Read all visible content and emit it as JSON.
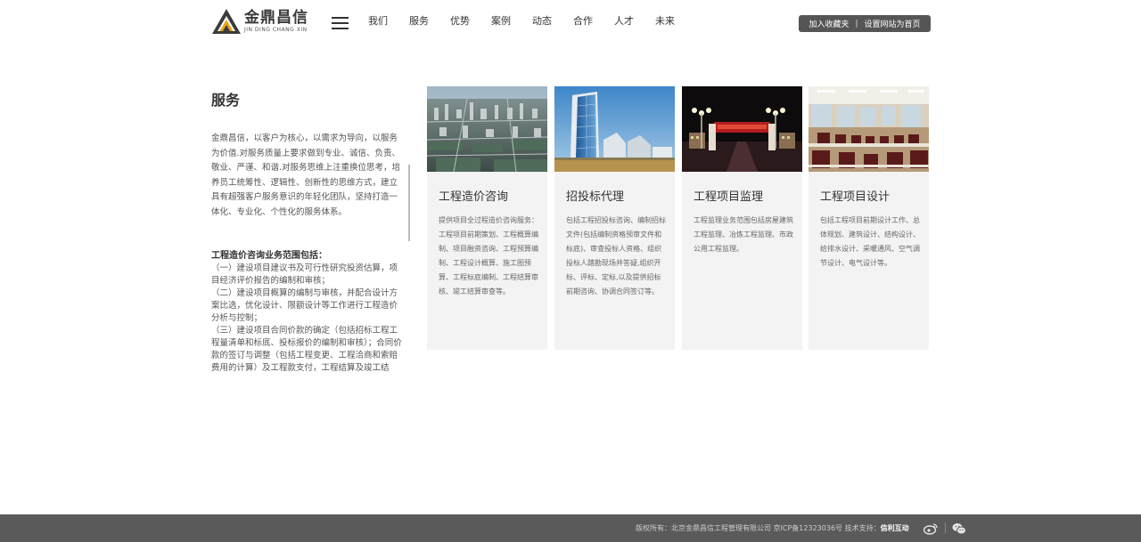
{
  "brand": {
    "name_cn": "金鼎昌信",
    "name_en": "JIN DING CHANG XIN"
  },
  "nav": {
    "items": [
      "我们",
      "服务",
      "优势",
      "案例",
      "动态",
      "合作",
      "人才",
      "未来"
    ]
  },
  "top_actions": {
    "bookmark": "加入收藏夹",
    "separator": "|",
    "homepage": "设置网站为首页"
  },
  "sidebar": {
    "title": "服务",
    "intro": "金鼎昌信，以客户为核心，以需求为导向，以服务为价值.对服务质量上要求做到专业、诚信、负责、敬业、严谨、和谐.对服务思维上注重换位思考，培养员工统筹性、逻辑性、创新性的思维方式，建立具有超强客户服务意识的年轻化团队，坚持打造一体化、专业化、个性化的服务体系。",
    "scope_title": "工程造价咨询业务范围包括：",
    "scope_items": [
      "（一）建设项目建议书及可行性研究投资估算，项目经济评价报告的编制和审核；",
      "（二）建设项目概算的编制与审核，并配合设计方案比选，优化设计、限额设计等工作进行工程造价分析与控制；",
      "（三）建设项目合同价款的确定（包括招标工程工程量清单和标底、投标报价的编制和审核）；合同价款的签订与调整（包括工程变更、工程洽商和索赔费用的计算）及工程款支付，工程结算及竣工结"
    ]
  },
  "cards": [
    {
      "title": "工程造价咨询",
      "desc": "提供项目全过程造价咨询服务：工程项目前期策划、工程概算编制、项目融资咨询、工程预算编制、工程设计概算、施工图预算、工程标底编制、工程结算审核、竣工结算审查等。",
      "image": "city-aerial-photo"
    },
    {
      "title": "招投标代理",
      "desc": "包括工程招投标咨询、编制招标文件(包括编制资格预审文件和标底)、审查投标人资格、组织投标人踏勘现场并答疑,组织开标、评标、定标,以及提供招标前期咨询、协调合同签订等。",
      "image": "glass-tower-photo"
    },
    {
      "title": "工程项目监理",
      "desc": "工程监理业务范围包括房屋建筑工程监理、冶炼工程监理、市政公用工程监理。",
      "image": "night-gate-photo"
    },
    {
      "title": "工程项目设计",
      "desc": "包括工程项目前期设计工作、总体规划、建筑设计、结构设计、给排水设计、采暖通风、空气调节设计、电气设计等。",
      "image": "meeting-room-photo"
    }
  ],
  "footer": {
    "copyright": "版权所有：北京金鼎昌信工程管理有限公司 京ICP备12323036号 技术支持：",
    "support": "信利互动",
    "icons": [
      "weibo-icon",
      "wechat-icon"
    ]
  }
}
